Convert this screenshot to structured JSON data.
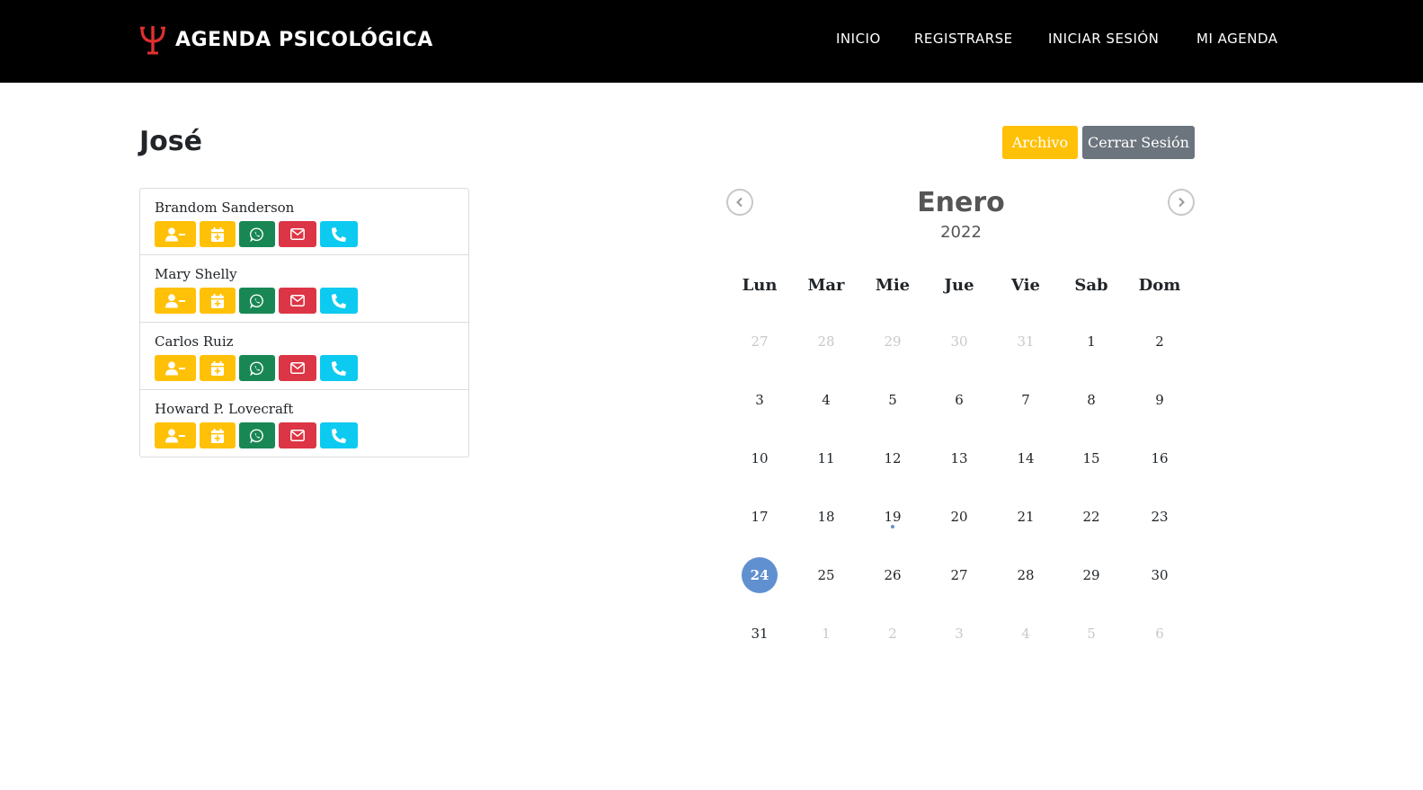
{
  "navbar": {
    "brand_symbol": "Ψ",
    "brand_text": "AGENDA PSICOLÓGICA",
    "links": [
      "INICIO",
      "REGISTRARSE",
      "INICIAR SESIÓN",
      "MI AGENDA"
    ]
  },
  "page": {
    "user_name": "José",
    "archivo_label": "Archivo",
    "logout_label": "Cerrar Sesión"
  },
  "patients": [
    {
      "name": "Brandom Sanderson"
    },
    {
      "name": "Mary Shelly"
    },
    {
      "name": "Carlos Ruiz"
    },
    {
      "name": "Howard P. Lovecraft"
    }
  ],
  "patient_actions": [
    "remove-user-icon",
    "calendar-plus-icon",
    "whatsapp-icon",
    "envelope-icon",
    "phone-icon"
  ],
  "calendar": {
    "month": "Enero",
    "year": "2022",
    "weekdays": [
      "Lun",
      "Mar",
      "Mie",
      "Jue",
      "Vie",
      "Sab",
      "Dom"
    ],
    "weeks": [
      [
        {
          "d": "27",
          "m": true
        },
        {
          "d": "28",
          "m": true
        },
        {
          "d": "29",
          "m": true
        },
        {
          "d": "30",
          "m": true
        },
        {
          "d": "31",
          "m": true
        },
        {
          "d": "1"
        },
        {
          "d": "2"
        }
      ],
      [
        {
          "d": "3"
        },
        {
          "d": "4"
        },
        {
          "d": "5"
        },
        {
          "d": "6"
        },
        {
          "d": "7"
        },
        {
          "d": "8"
        },
        {
          "d": "9"
        }
      ],
      [
        {
          "d": "10"
        },
        {
          "d": "11"
        },
        {
          "d": "12"
        },
        {
          "d": "13"
        },
        {
          "d": "14"
        },
        {
          "d": "15"
        },
        {
          "d": "16"
        }
      ],
      [
        {
          "d": "17"
        },
        {
          "d": "18"
        },
        {
          "d": "19",
          "event": true
        },
        {
          "d": "20"
        },
        {
          "d": "21"
        },
        {
          "d": "22"
        },
        {
          "d": "23"
        }
      ],
      [
        {
          "d": "24",
          "today": true
        },
        {
          "d": "25"
        },
        {
          "d": "26"
        },
        {
          "d": "27"
        },
        {
          "d": "28"
        },
        {
          "d": "29"
        },
        {
          "d": "30"
        }
      ],
      [
        {
          "d": "31"
        },
        {
          "d": "1",
          "m": true
        },
        {
          "d": "2",
          "m": true
        },
        {
          "d": "3",
          "m": true
        },
        {
          "d": "4",
          "m": true
        },
        {
          "d": "5",
          "m": true
        },
        {
          "d": "6",
          "m": true
        }
      ]
    ]
  },
  "colors": {
    "navbar_bg": "#000000",
    "brand_accent": "#e03030",
    "warning": "#ffc107",
    "secondary": "#6c757d",
    "success": "#198754",
    "danger": "#dc3545",
    "info": "#0dcaf0",
    "today": "#6090d0"
  }
}
